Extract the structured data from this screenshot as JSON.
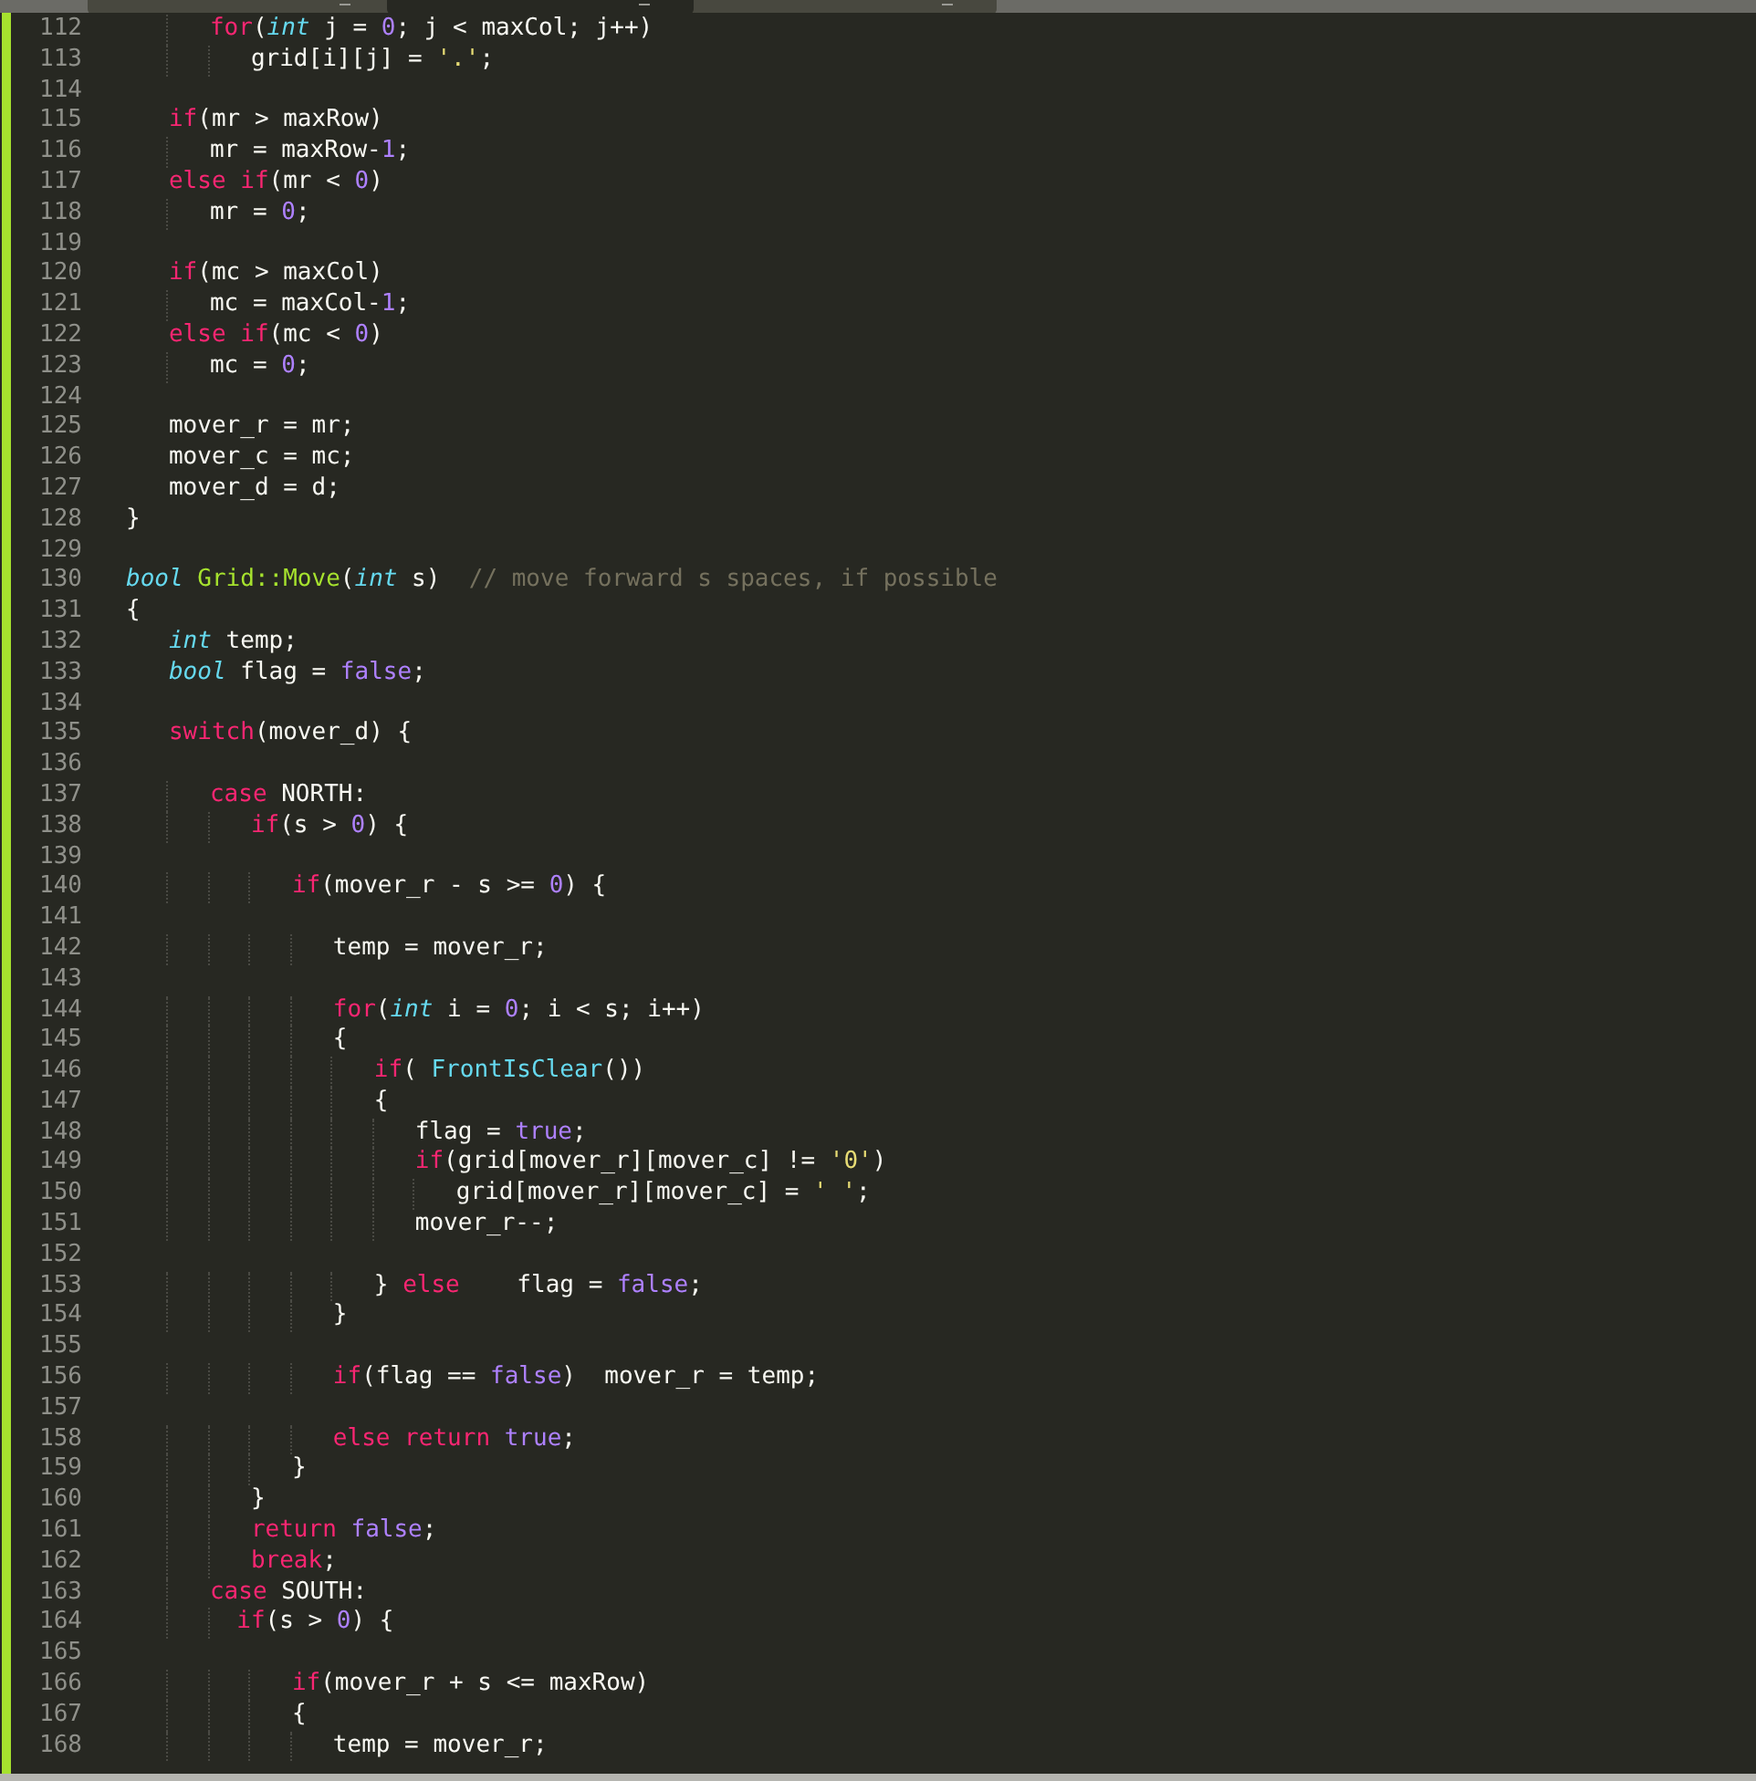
{
  "tabs": [
    {
      "selected": false
    },
    {
      "selected": true
    },
    {
      "selected": false
    }
  ],
  "editor": {
    "lines": [
      {
        "number": "112",
        "tokens": [
          {
            "kind": "keyword",
            "text": "      for"
          },
          {
            "kind": "plain",
            "text": "("
          },
          {
            "kind": "type",
            "text": "int"
          },
          {
            "kind": "plain",
            "text": " j = "
          },
          {
            "kind": "number",
            "text": "0"
          },
          {
            "kind": "plain",
            "text": "; j < maxCol; j++)"
          }
        ]
      },
      {
        "number": "113",
        "tokens": [
          {
            "kind": "plain",
            "text": "         grid[i][j] = "
          },
          {
            "kind": "string",
            "text": "'.'"
          },
          {
            "kind": "plain",
            "text": ";"
          }
        ]
      },
      {
        "number": "114"
      },
      {
        "number": "115",
        "tokens": [
          {
            "kind": "keyword",
            "text": "   if"
          },
          {
            "kind": "plain",
            "text": "(mr > maxRow)"
          }
        ]
      },
      {
        "number": "116",
        "tokens": [
          {
            "kind": "plain",
            "text": "      mr = maxRow-"
          },
          {
            "kind": "number",
            "text": "1"
          },
          {
            "kind": "plain",
            "text": ";"
          }
        ]
      },
      {
        "number": "117",
        "tokens": [
          {
            "kind": "keyword",
            "text": "   else if"
          },
          {
            "kind": "plain",
            "text": "(mr < "
          },
          {
            "kind": "number",
            "text": "0"
          },
          {
            "kind": "plain",
            "text": ")"
          }
        ]
      },
      {
        "number": "118",
        "tokens": [
          {
            "kind": "plain",
            "text": "      mr = "
          },
          {
            "kind": "number",
            "text": "0"
          },
          {
            "kind": "plain",
            "text": ";"
          }
        ]
      },
      {
        "number": "119"
      },
      {
        "number": "120",
        "tokens": [
          {
            "kind": "keyword",
            "text": "   if"
          },
          {
            "kind": "plain",
            "text": "(mc > maxCol)"
          }
        ]
      },
      {
        "number": "121",
        "tokens": [
          {
            "kind": "plain",
            "text": "      mc = maxCol-"
          },
          {
            "kind": "number",
            "text": "1"
          },
          {
            "kind": "plain",
            "text": ";"
          }
        ]
      },
      {
        "number": "122",
        "tokens": [
          {
            "kind": "keyword",
            "text": "   else if"
          },
          {
            "kind": "plain",
            "text": "(mc < "
          },
          {
            "kind": "number",
            "text": "0"
          },
          {
            "kind": "plain",
            "text": ")"
          }
        ]
      },
      {
        "number": "123",
        "tokens": [
          {
            "kind": "plain",
            "text": "      mc = "
          },
          {
            "kind": "number",
            "text": "0"
          },
          {
            "kind": "plain",
            "text": ";"
          }
        ]
      },
      {
        "number": "124"
      },
      {
        "number": "125",
        "tokens": [
          {
            "kind": "plain",
            "text": "   mover_r = mr;"
          }
        ]
      },
      {
        "number": "126",
        "tokens": [
          {
            "kind": "plain",
            "text": "   mover_c = mc;"
          }
        ]
      },
      {
        "number": "127",
        "tokens": [
          {
            "kind": "plain",
            "text": "   mover_d = d;"
          }
        ]
      },
      {
        "number": "128",
        "tokens": [
          {
            "kind": "plain",
            "text": "}"
          }
        ]
      },
      {
        "number": "129"
      },
      {
        "number": "130",
        "tokens": [
          {
            "kind": "type",
            "text": "bool "
          },
          {
            "kind": "function",
            "text": "Grid::Move"
          },
          {
            "kind": "plain",
            "text": "("
          },
          {
            "kind": "type",
            "text": "int"
          },
          {
            "kind": "plain",
            "text": " s)  "
          },
          {
            "kind": "comment",
            "text": "// move forward s spaces, if possible"
          }
        ]
      },
      {
        "number": "131",
        "tokens": [
          {
            "kind": "plain",
            "text": "{"
          }
        ]
      },
      {
        "number": "132",
        "tokens": [
          {
            "kind": "type",
            "text": "   int"
          },
          {
            "kind": "plain",
            "text": " temp;"
          }
        ]
      },
      {
        "number": "133",
        "tokens": [
          {
            "kind": "type",
            "text": "   bool"
          },
          {
            "kind": "plain",
            "text": " flag = "
          },
          {
            "kind": "number",
            "text": "false"
          },
          {
            "kind": "plain",
            "text": ";"
          }
        ]
      },
      {
        "number": "134"
      },
      {
        "number": "135",
        "tokens": [
          {
            "kind": "keyword",
            "text": "   switch"
          },
          {
            "kind": "plain",
            "text": "(mover_d) {"
          }
        ]
      },
      {
        "number": "136"
      },
      {
        "number": "137",
        "tokens": [
          {
            "kind": "keyword",
            "text": "      case"
          },
          {
            "kind": "plain",
            "text": " NORTH:"
          }
        ]
      },
      {
        "number": "138",
        "tokens": [
          {
            "kind": "keyword",
            "text": "         if"
          },
          {
            "kind": "plain",
            "text": "(s > "
          },
          {
            "kind": "number",
            "text": "0"
          },
          {
            "kind": "plain",
            "text": ") {"
          }
        ]
      },
      {
        "number": "139"
      },
      {
        "number": "140",
        "tokens": [
          {
            "kind": "keyword",
            "text": "            if"
          },
          {
            "kind": "plain",
            "text": "(mover_r - s >= "
          },
          {
            "kind": "number",
            "text": "0"
          },
          {
            "kind": "plain",
            "text": ") {"
          }
        ]
      },
      {
        "number": "141"
      },
      {
        "number": "142",
        "tokens": [
          {
            "kind": "plain",
            "text": "               temp = mover_r;"
          }
        ]
      },
      {
        "number": "143"
      },
      {
        "number": "144",
        "tokens": [
          {
            "kind": "keyword",
            "text": "               for"
          },
          {
            "kind": "plain",
            "text": "("
          },
          {
            "kind": "type",
            "text": "int"
          },
          {
            "kind": "plain",
            "text": " i = "
          },
          {
            "kind": "number",
            "text": "0"
          },
          {
            "kind": "plain",
            "text": "; i < s; i++)"
          }
        ]
      },
      {
        "number": "145",
        "tokens": [
          {
            "kind": "plain",
            "text": "               {"
          }
        ]
      },
      {
        "number": "146",
        "tokens": [
          {
            "kind": "keyword",
            "text": "                  if"
          },
          {
            "kind": "plain",
            "text": "( "
          },
          {
            "kind": "call",
            "text": "FrontIsClear"
          },
          {
            "kind": "plain",
            "text": "())"
          }
        ]
      },
      {
        "number": "147",
        "tokens": [
          {
            "kind": "plain",
            "text": "                  {"
          }
        ]
      },
      {
        "number": "148",
        "tokens": [
          {
            "kind": "plain",
            "text": "                     flag = "
          },
          {
            "kind": "number",
            "text": "true"
          },
          {
            "kind": "plain",
            "text": ";"
          }
        ]
      },
      {
        "number": "149",
        "tokens": [
          {
            "kind": "keyword",
            "text": "                     if"
          },
          {
            "kind": "plain",
            "text": "(grid[mover_r][mover_c] != "
          },
          {
            "kind": "string",
            "text": "'0'"
          },
          {
            "kind": "plain",
            "text": ")"
          }
        ]
      },
      {
        "number": "150",
        "tokens": [
          {
            "kind": "plain",
            "text": "                        grid[mover_r][mover_c] = "
          },
          {
            "kind": "string",
            "text": "' '"
          },
          {
            "kind": "plain",
            "text": ";"
          }
        ]
      },
      {
        "number": "151",
        "tokens": [
          {
            "kind": "plain",
            "text": "                     mover_r--;"
          }
        ]
      },
      {
        "number": "152"
      },
      {
        "number": "153",
        "tokens": [
          {
            "kind": "plain",
            "text": "                  } "
          },
          {
            "kind": "keyword",
            "text": "else"
          },
          {
            "kind": "plain",
            "text": "    flag = "
          },
          {
            "kind": "number",
            "text": "false"
          },
          {
            "kind": "plain",
            "text": ";"
          }
        ]
      },
      {
        "number": "154",
        "tokens": [
          {
            "kind": "plain",
            "text": "               }"
          }
        ]
      },
      {
        "number": "155"
      },
      {
        "number": "156",
        "tokens": [
          {
            "kind": "keyword",
            "text": "               if"
          },
          {
            "kind": "plain",
            "text": "(flag == "
          },
          {
            "kind": "number",
            "text": "false"
          },
          {
            "kind": "plain",
            "text": ")  mover_r = temp;"
          }
        ]
      },
      {
        "number": "157"
      },
      {
        "number": "158",
        "tokens": [
          {
            "kind": "keyword",
            "text": "               else return "
          },
          {
            "kind": "number",
            "text": "true"
          },
          {
            "kind": "plain",
            "text": ";"
          }
        ]
      },
      {
        "number": "159",
        "tokens": [
          {
            "kind": "plain",
            "text": "            }"
          }
        ]
      },
      {
        "number": "160",
        "tokens": [
          {
            "kind": "plain",
            "text": "         }"
          }
        ]
      },
      {
        "number": "161",
        "tokens": [
          {
            "kind": "keyword",
            "text": "         return "
          },
          {
            "kind": "number",
            "text": "false"
          },
          {
            "kind": "plain",
            "text": ";"
          }
        ]
      },
      {
        "number": "162",
        "tokens": [
          {
            "kind": "keyword",
            "text": "         break"
          },
          {
            "kind": "plain",
            "text": ";"
          }
        ]
      },
      {
        "number": "163",
        "tokens": [
          {
            "kind": "keyword",
            "text": "      case"
          },
          {
            "kind": "plain",
            "text": " SOUTH:"
          }
        ]
      },
      {
        "number": "164",
        "tokens": [
          {
            "kind": "keyword",
            "text": "        if"
          },
          {
            "kind": "plain",
            "text": "(s > "
          },
          {
            "kind": "number",
            "text": "0"
          },
          {
            "kind": "plain",
            "text": ") {"
          }
        ]
      },
      {
        "number": "165"
      },
      {
        "number": "166",
        "tokens": [
          {
            "kind": "keyword",
            "text": "            if"
          },
          {
            "kind": "plain",
            "text": "(mover_r + s <= maxRow)"
          }
        ]
      },
      {
        "number": "167",
        "tokens": [
          {
            "kind": "plain",
            "text": "            {"
          }
        ]
      },
      {
        "number": "168",
        "tokens": [
          {
            "kind": "plain",
            "text": "               temp = mover_r;"
          }
        ]
      }
    ]
  }
}
